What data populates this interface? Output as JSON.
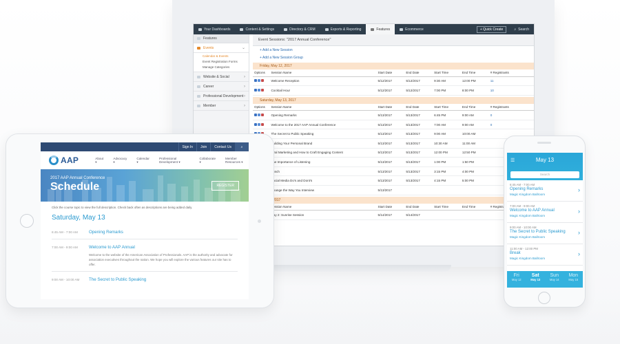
{
  "laptop": {
    "topnav": {
      "items": [
        {
          "label": "Your Dashboards",
          "icon": "dashboard-icon"
        },
        {
          "label": "Content & Settings",
          "icon": "settings-icon"
        },
        {
          "label": "Directory & CRM",
          "icon": "directory-icon"
        },
        {
          "label": "Exports & Reporting",
          "icon": "reports-icon"
        },
        {
          "label": "Features",
          "icon": "features-icon"
        },
        {
          "label": "Ecommerce",
          "icon": "cart-icon"
        }
      ],
      "active": "Features",
      "quick_create": "+ Quick Create",
      "search": "Search"
    },
    "sidebar": {
      "header": "Features",
      "events_label": "Events",
      "events_sub": [
        "Calendar & Events",
        "Event Registration Forms",
        "Manage Categories"
      ],
      "items": [
        "Website & Social",
        "Career",
        "Professional Development",
        "Member"
      ]
    },
    "page_title": "Event Sessions: \"2017 Annual Conference\"",
    "add_session": "+ Add a New Session",
    "add_group": "+ Add a New Session Group",
    "columns": [
      "Options",
      "Session Name",
      "Start Date",
      "End Date",
      "Start Time",
      "End Time",
      "# Registrants"
    ],
    "days": [
      {
        "label": "Friday, May 12, 2017",
        "rows": [
          [
            "Welcome Reception",
            "5/12/2017",
            "5/12/2017",
            "9:30 AM",
            "12:00 PM",
            "11"
          ],
          [
            "Cocktail Hour",
            "5/12/2017",
            "5/12/2017",
            "7:00 PM",
            "8:00 PM",
            "10"
          ]
        ]
      },
      {
        "label": "Saturday, May 13, 2017",
        "rows": [
          [
            "Opening Remarks",
            "5/13/2017",
            "5/13/2017",
            "6:45 PM",
            "9:00 AM",
            "0"
          ],
          [
            "Welcome to the 2017 AAP Annual Conference",
            "5/13/2017",
            "5/13/2017",
            "7:00 AM",
            "9:00 AM",
            "0"
          ],
          [
            "The Secret to Public Speaking",
            "5/13/2017",
            "5/13/2017",
            "9:00 AM",
            "10:00 AM",
            ""
          ],
          [
            "Building Your Personal Brand",
            "5/13/2017",
            "5/13/2017",
            "10:30 AM",
            "11:00 AM",
            ""
          ],
          [
            "Viral Marketing and How to Craft Engaging Content",
            "5/13/2017",
            "5/13/2017",
            "12:00 PM",
            "12:50 PM",
            ""
          ],
          [
            "The Importance of Listening",
            "5/13/2017",
            "5/13/2017",
            "1:00 PM",
            "1:50 PM",
            ""
          ],
          [
            "Lunch",
            "5/13/2017",
            "5/13/2017",
            "3:15 PM",
            "4:00 PM",
            ""
          ],
          [
            "Social Media Do's and Dont's",
            "5/13/2017",
            "5/13/2017",
            "4:15 PM",
            "5:00 PM",
            ""
          ],
          [
            "Change the Way You Interview",
            "5/13/2017",
            "",
            "",
            "",
            ""
          ]
        ]
      },
      {
        "label": "May 14, 2017",
        "rows": [
          [
            "Day 2: Sunrise Session",
            "5/14/2017",
            "5/14/2017",
            "",
            "",
            ""
          ]
        ]
      }
    ]
  },
  "tablet": {
    "top_links": [
      "Sign In",
      "Join",
      "Contact Us"
    ],
    "logo": "AAP",
    "nav": [
      "About",
      "Advocacy",
      "Calendar",
      "Professional Development",
      "Collaborate",
      "Member Resources"
    ],
    "banner_sub": "2017 AAP Annual Conference",
    "banner_title": "Schedule",
    "register": "REGISTER",
    "description": "Click the course topic to view the full description. Check back often as descriptions are being added daily.",
    "day": "Saturday, May 13",
    "sessions": [
      {
        "time": "6:45 AM - 7:00 AM",
        "title": "Opening Remarks",
        "body": ""
      },
      {
        "time": "7:00 AM - 9:00 AM",
        "title": "Welcome to AAP Annual",
        "body": "Welcome to the website of the American Association of Professionals. AAP is the authority and advocate for association executives throughout the nation. We hope you will explore the various features our site has to offer."
      },
      {
        "time": "9:00 AM - 10:00 AM",
        "title": "The Secret to Public Speaking",
        "body": ""
      }
    ]
  },
  "phone": {
    "date": "May 13",
    "search_placeholder": "Search",
    "sessions": [
      {
        "time": "6:45 AM - 7:00 AM",
        "title": "Opening Remarks",
        "location": "Magic Kingdom Ballroom"
      },
      {
        "time": "7:00 AM - 9:00 AM",
        "title": "Welcome to AAP Annual",
        "location": "Magic Kingdom Ballroom"
      },
      {
        "time": "9:00 AM - 10:00 AM",
        "title": "The Secret to Public Speaking",
        "location": "Magic Kingdom Ballroom"
      },
      {
        "time": "11:00 AM - 12:00 PM",
        "title": "Break",
        "location": "Magic Kingdom Ballroom"
      }
    ],
    "days": [
      {
        "name": "Fri",
        "date": "May 12",
        "active": false
      },
      {
        "name": "Sat",
        "date": "May 13",
        "active": true
      },
      {
        "name": "Sun",
        "date": "May 14",
        "active": false
      },
      {
        "name": "Mon",
        "date": "May 15",
        "active": false
      }
    ]
  }
}
